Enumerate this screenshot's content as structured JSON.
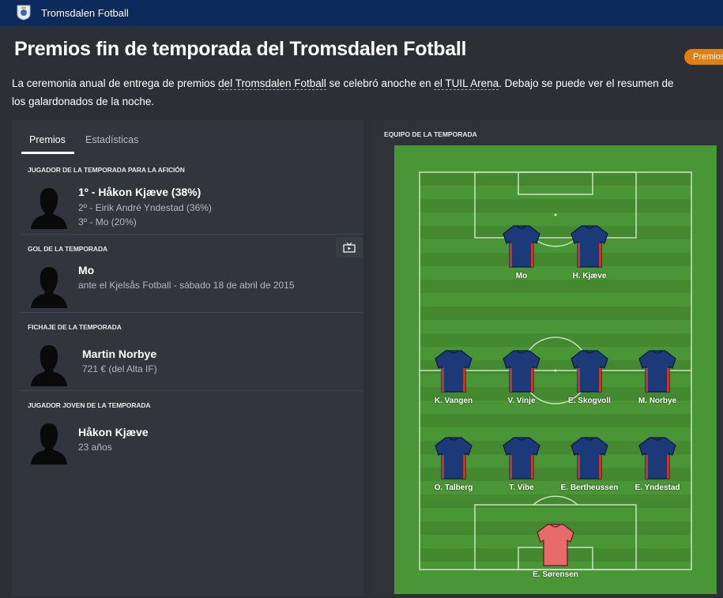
{
  "header": {
    "club_name": "Tromsdalen Fotball",
    "badge_icon": "club-crest-icon"
  },
  "page": {
    "title": "Premios fin de temporada del Tromsdalen Fotball",
    "pill_label": "Premios",
    "intro": {
      "p1": "La ceremonia anual de entrega de premios ",
      "link1": "del Tromsdalen Fotball",
      "p2": " se celebró anoche en ",
      "link2": "el TUIL Arena",
      "p3": ". Debajo se puede ver el resumen de",
      "line2": "los galardonados de la noche."
    }
  },
  "tabs": [
    {
      "label": "Premios",
      "active": true
    },
    {
      "label": "Estadísticas",
      "active": false
    }
  ],
  "awards": [
    {
      "heading": "JUGADOR DE LA TEMPORADA PARA LA AFICIÓN",
      "winner": "1º - Håkon Kjæve (38%)",
      "lines": [
        "2º - Eirik André Yndestad (36%)",
        "3º - Mo (20%)"
      ]
    },
    {
      "heading": "GOL DE LA TEMPORADA",
      "winner": "Mo",
      "lines": [
        "ante el Kjelsås Fotball - sábado 18 de abril de 2015"
      ]
    },
    {
      "heading": "FICHAJE DE LA TEMPORADA",
      "winner": "Martin Norbye",
      "lines": [
        "721 € (del Alta IF)"
      ]
    },
    {
      "heading": "JUGADOR JOVEN DE LA TEMPORADA",
      "winner": "Håkon Kjæve",
      "lines": [
        "23 años"
      ]
    }
  ],
  "team_of_season": {
    "heading": "EQUIPO DE LA TEMPORADA",
    "forwards": [
      "Mo",
      "H. Kjæve"
    ],
    "midfielders": [
      "K. Vangen",
      "V. Vinje",
      "E. Skogvoll",
      "M. Norbye"
    ],
    "defenders": [
      "O. Talberg",
      "T. Vibe",
      "E. Bertheussen",
      "E. Yndestad"
    ],
    "goalkeeper": "E. Sørensen"
  },
  "colors": {
    "topbar": "#0d2a5c",
    "pill": "#e07f13",
    "pitch_light": "#4f9a3a",
    "pitch_dark": "#468d33",
    "shirt": "#1c3a7a",
    "gk_shirt": "#e86b6b"
  }
}
